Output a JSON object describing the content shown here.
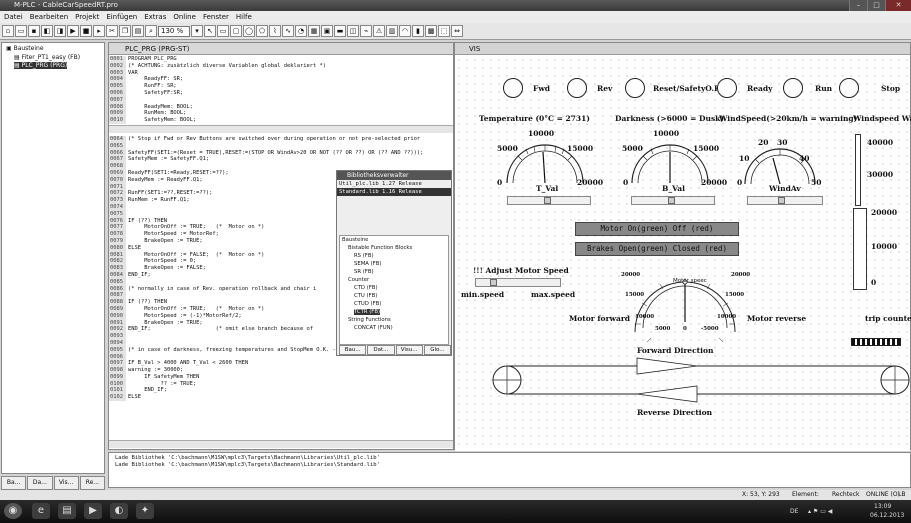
{
  "app": {
    "title": "M-PLC - CableCarSpeedRT.pro",
    "win_min": "–",
    "win_max": "□",
    "win_close": "✕"
  },
  "menu": [
    "Datei",
    "Bearbeiten",
    "Projekt",
    "Einfügen",
    "Extras",
    "Online",
    "Fenster",
    "Hilfe"
  ],
  "toolbar": {
    "zoom": "130 %"
  },
  "tree": {
    "root": "Bausteine",
    "items": [
      "Fiter_PT1_easy (FB)",
      "PLC_PRG (PRG)"
    ]
  },
  "tree_tabs": [
    "Ba...",
    "Da...",
    "Vis...",
    "Re..."
  ],
  "editor": {
    "title": "PLC_PRG (PRG-ST)",
    "decl": [
      [
        "0001",
        "PROGRAM PLC_PRG"
      ],
      [
        "0002",
        "(* ACHTUNG: zusätzlich diverse Variablen global deklariert *)"
      ],
      [
        "0003",
        "VAR"
      ],
      [
        "0004",
        "     ReadyFF: SR;"
      ],
      [
        "0005",
        "     RunFF: SR;"
      ],
      [
        "0006",
        "     SafetyFF:SR;"
      ],
      [
        "0007",
        ""
      ],
      [
        "0008",
        "     ReadyMem: BOOL;"
      ],
      [
        "0009",
        "     RunMem: BOOL;"
      ],
      [
        "0010",
        "     SafetyMem: BOOL;"
      ]
    ],
    "body": [
      [
        "0064",
        "(* Stop if Fwd or Rev Buttons are switched over during operation or not pre-selected prior"
      ],
      [
        "0065",
        ""
      ],
      [
        "0066",
        "SafetyFF(SET1:=(Reset = TRUE),RESET:=(STOP OR WindAv>20 OR NOT (?? OR ??) OR (?? AND ??)));"
      ],
      [
        "0067",
        "SafetyMem := SafetyFF.Q1;"
      ],
      [
        "0068",
        ""
      ],
      [
        "0069",
        "ReadyFF(SET1:=Ready,RESET:=??);"
      ],
      [
        "0070",
        "ReadyMem := ReadyFF.Q1;"
      ],
      [
        "0071",
        ""
      ],
      [
        "0072",
        "RunFF(SET1:=??,RESET:=??);"
      ],
      [
        "0073",
        "RunMem := RunFF.Q1;"
      ],
      [
        "0074",
        ""
      ],
      [
        "0075",
        ""
      ],
      [
        "0076",
        "IF (??) THEN"
      ],
      [
        "0077",
        "     MotorOnOff := TRUE;   (*  Motor on *)"
      ],
      [
        "0078",
        "     MotorSpeed := MotorRef;"
      ],
      [
        "0079",
        "     BrakeOpen := TRUE;"
      ],
      [
        "0080",
        "ELSE"
      ],
      [
        "0081",
        "     MotorOnOff := FALSE;  (*  Motor on *)"
      ],
      [
        "0082",
        "     MotorSpeed := 0;"
      ],
      [
        "0083",
        "     BrakeOpen := FALSE;"
      ],
      [
        "0084",
        "END_IF;"
      ],
      [
        "0085",
        ""
      ],
      [
        "0086",
        "(* normally in case of Rev. operation rollback and chair i"
      ],
      [
        "0087",
        ""
      ],
      [
        "0088",
        "IF (??) THEN"
      ],
      [
        "0089",
        "     MotorOnOff := TRUE;   (*  Motor on *)"
      ],
      [
        "0090",
        "     MotorSpeed := (-1)*MotorRef/2;"
      ],
      [
        "0091",
        "     BrakeOpen := TRUE;"
      ],
      [
        "0092",
        "END_IF;                    (* omit else branch because of"
      ],
      [
        "0093",
        ""
      ],
      [
        "0094",
        ""
      ],
      [
        "0095",
        "(* in case of darkness, freezing temperatures and StopMem O.K. -> de-icing movement at nigh"
      ],
      [
        "0096",
        ""
      ],
      [
        "0097",
        "IF B_Val > 4000 AND T_Val < 2600 THEN"
      ],
      [
        "0098",
        "warning := 30000;"
      ],
      [
        "0099",
        "     IF SafetyMem THEN"
      ],
      [
        "0100",
        "          ?? := TRUE;"
      ],
      [
        "0101",
        "     END_IF;"
      ],
      [
        "0102",
        "ELSE"
      ]
    ]
  },
  "library": {
    "title": "Bibliotheksverwalter",
    "files": [
      "Util_plc.lib 1.27 Release",
      "Standard.lib 1.16 Release"
    ],
    "tree": [
      "Bausteine",
      "Bistable Function Blocks",
      "RS (FB)",
      "SEMA (FB)",
      "SR (FB)",
      "Counter",
      "CTD (FB)",
      "CTU (FB)",
      "CTUD (FB)",
      "TCTR (FB)",
      "String Functions",
      "CONCAT (FUN)"
    ],
    "tabs": [
      "Bau...",
      "Dat...",
      "Visu...",
      "Glo..."
    ]
  },
  "vis": {
    "title": "VIS",
    "buttons": [
      "Fwd",
      "Rev",
      "Reset/SafetyO.K.",
      "Ready",
      "Run",
      "Stop"
    ],
    "headers": [
      "Temperature (0°C = 2731)",
      "Darkness (>6000 = Dusk)",
      "WindSpeed(>20km/h = warning)",
      "Windspeed Warn"
    ],
    "gauges": [
      {
        "label": "T_Val",
        "min": "0",
        "max": "20000",
        "l": "5000",
        "m": "10000",
        "r": "15000"
      },
      {
        "label": "B_Val",
        "min": "0",
        "max": "20000",
        "l": "5000",
        "m": "10000",
        "r": "15000"
      },
      {
        "label": "WindAv",
        "min": "0",
        "max": "50",
        "l": "10",
        "m": "20",
        "m2": "30",
        "r": "40"
      }
    ],
    "warn_scale": [
      "40000",
      "30000"
    ],
    "vbar_scale": [
      "20000",
      "10000",
      "0"
    ],
    "motor_bar": "Motor On(green) Off (red)",
    "brake_bar": "Brakes Open(green) Closed (red)",
    "adjust": "!!! Adjust Motor Speed",
    "minspeed": "min.speed",
    "maxspeed": "max.speed",
    "motor_fwd": "Motor forward",
    "motor_rev": "Motor reverse",
    "motorspeed": "Motor speec",
    "speed_ticks": [
      "20000",
      "20000",
      "15000",
      "15000",
      "10000",
      "10000",
      "5000",
      "0",
      "-5000"
    ],
    "trip": "trip counter",
    "fwd_dir": "Forward Direction",
    "rev_dir": "Reverse Direction"
  },
  "output": [
    "Lade Bibliothek 'C:\\bachmann\\M1SW\\mplc3\\Targets\\Bachmann\\Libraries\\Util_plc.lib'",
    "Lade Bibliothek 'C:\\bachmann\\M1SW\\mplc3\\Targets\\Bachmann\\Libraries\\Standard.lib'"
  ],
  "status": {
    "pos": "X: 53, Y: 293",
    "element": "Element:",
    "mode": "Rechteck",
    "online": "ONLINE (O)",
    "lb": "LB"
  },
  "tray": {
    "lang": "DE",
    "time": "13:09",
    "date": "06.12.2013"
  }
}
